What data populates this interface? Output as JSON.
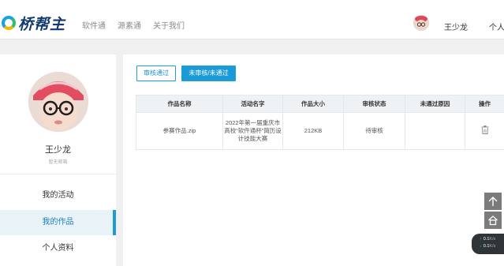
{
  "header": {
    "logo_text": "桥帮主",
    "nav": [
      "软件通",
      "源素通",
      "关于我们"
    ],
    "user_name": "王少龙",
    "user_menu": "个人"
  },
  "sidebar": {
    "name": "王少龙",
    "email_note": "暂无邮箱",
    "items": [
      {
        "label": "我的活动",
        "active": false
      },
      {
        "label": "我的作品",
        "active": true
      },
      {
        "label": "个人资料",
        "active": false
      }
    ]
  },
  "filters": {
    "passed": "审核通过",
    "pending": "未审核/未通过"
  },
  "table": {
    "headers": [
      "作品名称",
      "活动名字",
      "作品大小",
      "审核状态",
      "未通过原因",
      "操作"
    ],
    "rows": [
      {
        "name": "参赛作品.zip",
        "activity": "2022年第一届重庆市高校“软件通杯”简历设计技能大赛",
        "size": "212KB",
        "status": "待审核",
        "reason": ""
      }
    ]
  },
  "widget": {
    "up_speed": "0.1",
    "down_speed": "0.1",
    "unit": "K/s"
  },
  "colors": {
    "accent": "#1a9ad6",
    "brand_dark": "#123a6f"
  }
}
